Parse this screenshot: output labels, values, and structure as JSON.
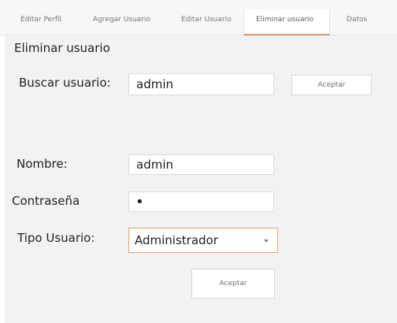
{
  "tabs": [
    {
      "label": "Editar Perfil"
    },
    {
      "label": "Agregar Usuario"
    },
    {
      "label": "Editar Usuario"
    },
    {
      "label": "Eliminar usuario"
    },
    {
      "label": "Datos"
    }
  ],
  "active_tab": "Eliminar usuario",
  "accent_color": "#e8a06f",
  "form": {
    "section_title": "Eliminar usuario",
    "search_label": "Buscar usuario:",
    "search_value": "admin",
    "search_button": "Aceptar",
    "name_label": "Nombre:",
    "name_value": "admin",
    "password_label": "Contraseña",
    "password_value": "•",
    "type_label": "Tipo Usuario:",
    "type_value": "Administrador",
    "type_chevron_icon": "chevron-down-icon",
    "submit_button": "Aceptar"
  }
}
